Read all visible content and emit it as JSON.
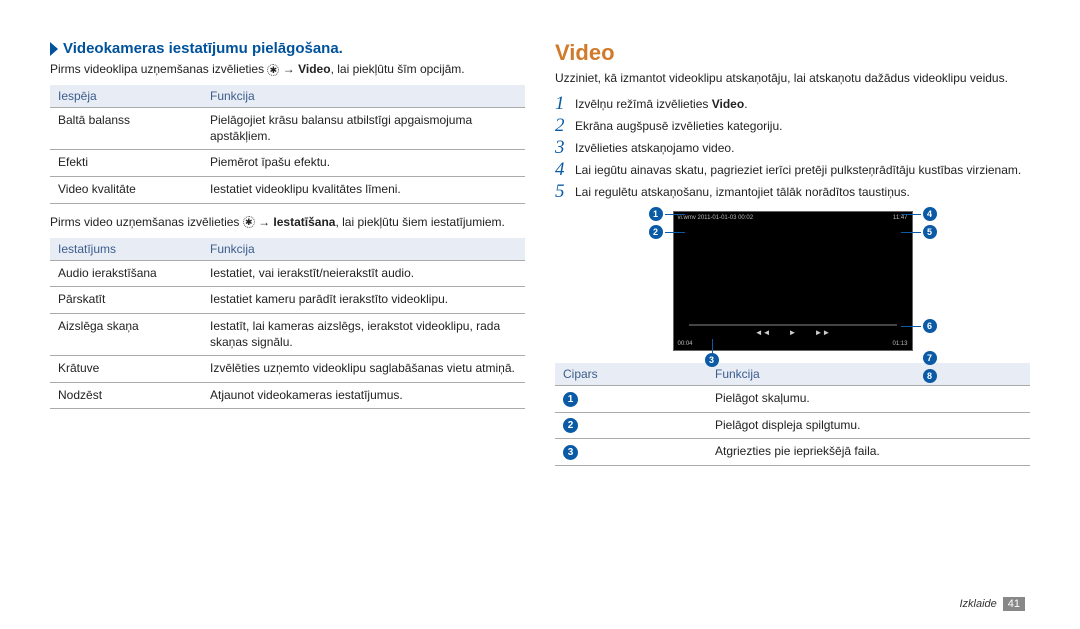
{
  "left": {
    "subheading": "Videokameras iestatījumu pielāgošana.",
    "intro_before": "Pirms videoklipa uzņemšanas izvēlieties ",
    "intro_after": " → ",
    "intro_bold": "Video",
    "intro_tail": ", lai piekļūtu šīm opcijām.",
    "table1_h1": "Iespēja",
    "table1_h2": "Funkcija",
    "t1r1c1": "Baltā balanss",
    "t1r1c2": "Pielāgojiet krāsu balansu atbilstīgi apgaismojuma apstākļiem.",
    "t1r2c1": "Efekti",
    "t1r2c2": "Piemērot īpašu efektu.",
    "t1r3c1": "Video kvalitāte",
    "t1r3c2": "Iestatiet videoklipu kvalitātes līmeni.",
    "mid_before": "Pirms video uzņemšanas izvēlieties ",
    "mid_after": " → ",
    "mid_bold": "Iestatīšana",
    "mid_tail": ", lai piekļūtu šiem iestatījumiem.",
    "table2_h1": "Iestatījums",
    "table2_h2": "Funkcija",
    "t2r1c1": "Audio ierakstīšana",
    "t2r1c2": "Iestatiet, vai ierakstīt/neierakstīt audio.",
    "t2r2c1": "Pārskatīt",
    "t2r2c2": "Iestatiet kameru parādīt ierakstīto videoklipu.",
    "t2r3c1": "Aizslēga skaņa",
    "t2r3c2": "Iestatīt, lai kameras aizslēgs, ierakstot videoklipu, rada skaņas signālu.",
    "t2r4c1": "Krātuve",
    "t2r4c2": "Izvēlēties uzņemto videoklipu saglabāšanas vietu atmiņā.",
    "t2r5c1": "Nodzēst",
    "t2r5c2": "Atjaunot videokameras iestatījumus."
  },
  "right": {
    "title": "Video",
    "intro": "Uzziniet, kā izmantot videoklipu atskaņotāju, lai atskaņotu dažādus videoklipu veidus.",
    "s1a": "Izvēlņu režīmā izvēlieties ",
    "s1b": "Video",
    "s1c": ".",
    "s2": "Ekrāna augšpusē izvēlieties kategoriju.",
    "s3": "Izvēlieties atskaņojamo video.",
    "s4": "Lai iegūtu ainavas skatu, pagrieziet ierīci pretēji pulksteņrādītāju kustības virzienam.",
    "s5": "Lai regulētu atskaņošanu, izmantojiet tālāk norādītos taustiņus.",
    "player_tl": "vi.wmv 2011-01-01-03 00:02",
    "player_tr": "11:47",
    "player_bl": "00:04",
    "player_br": "01:13",
    "tb_h1": "Cipars",
    "tb_h2": "Funkcija",
    "tbr1": "Pielāgot skaļumu.",
    "tbr2": "Pielāgot displeja spilgtumu.",
    "tbr3": "Atgriezties pie iepriekšējā faila."
  },
  "callouts": {
    "c1": "1",
    "c2": "2",
    "c3": "3",
    "c4": "4",
    "c5": "5",
    "c6": "6",
    "c7": "7",
    "c8": "8"
  },
  "footer_section": "Izklaide",
  "footer_page": "41"
}
